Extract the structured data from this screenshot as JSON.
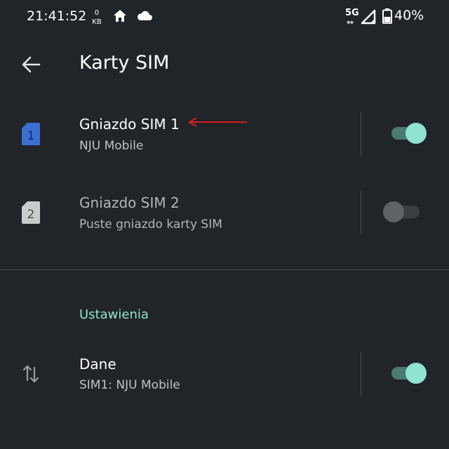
{
  "status_bar": {
    "time": "21:41:52",
    "data_rate_value": "0",
    "data_rate_unit": "KB",
    "network_type": "5G",
    "battery_percent": "40%",
    "icons": [
      "home-icon",
      "cloud-icon",
      "signal-icon",
      "battery-icon"
    ]
  },
  "toolbar": {
    "title": "Karty SIM",
    "back_icon": "arrow-back-icon"
  },
  "sim_slots": [
    {
      "badge": "1",
      "title": "Gniazdo SIM 1",
      "subtitle": "NJU Mobile",
      "enabled": true,
      "badge_color": "#3b6fd4"
    },
    {
      "badge": "2",
      "title": "Gniazdo SIM 2",
      "subtitle": "Puste gniazdo karty SIM",
      "enabled": false,
      "badge_color": "#c9cbcd"
    }
  ],
  "settings": {
    "header": "Ustawienia",
    "data_row": {
      "title": "Dane",
      "subtitle": "SIM1: NJU Mobile",
      "enabled": true,
      "icon": "swap-vertical-icon"
    }
  },
  "colors": {
    "background": "#212428",
    "accent": "#8fe3cf",
    "annotation": "#d91c1c"
  }
}
